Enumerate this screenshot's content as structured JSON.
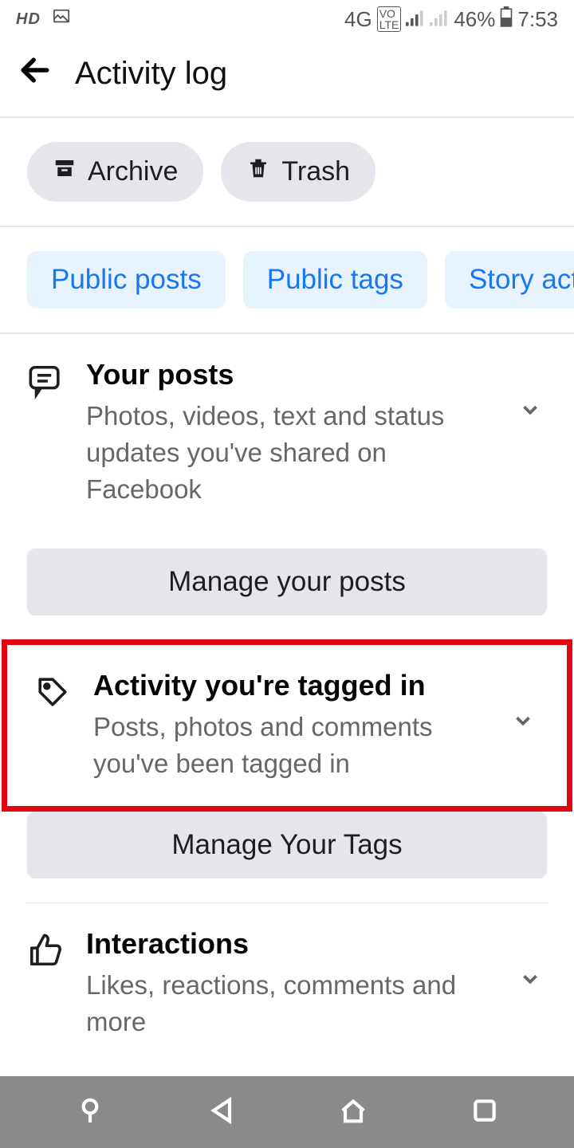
{
  "statusbar": {
    "hd": "HD",
    "network": "4G",
    "volte": "VO LTE",
    "battery_pct": "46%",
    "time": "7:53"
  },
  "header": {
    "title": "Activity log"
  },
  "pills": {
    "archive": "Archive",
    "trash": "Trash"
  },
  "filters": {
    "public_posts": "Public posts",
    "public_tags": "Public tags",
    "story_activity": "Story acti"
  },
  "sections": {
    "your_posts": {
      "title": "Your posts",
      "desc": "Photos, videos, text and status updates you've shared on Facebook",
      "manage": "Manage your posts"
    },
    "tagged": {
      "title": "Activity you're tagged in",
      "desc": "Posts, photos and comments you've been tagged in",
      "manage": "Manage Your Tags"
    },
    "interactions": {
      "title": "Interactions",
      "desc": "Likes, reactions, comments and more"
    }
  }
}
